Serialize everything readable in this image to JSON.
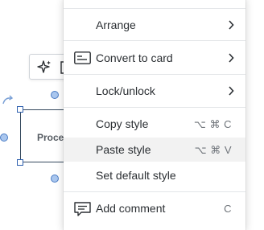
{
  "canvas": {
    "shape_label": "Proce"
  },
  "menu": {
    "arrange": {
      "label": "Arrange",
      "icon": "chevron-right-icon"
    },
    "convert_to_card": {
      "label": "Convert to card",
      "icon": "card-icon"
    },
    "lock_unlock": {
      "label": "Lock/unlock"
    },
    "copy_style": {
      "label": "Copy style",
      "shortcut": "⌥ ⌘ C"
    },
    "paste_style": {
      "label": "Paste style",
      "shortcut": "⌥ ⌘ V"
    },
    "set_default_style": {
      "label": "Set default style"
    },
    "add_comment": {
      "label": "Add comment",
      "shortcut": "C",
      "icon": "comment-icon"
    }
  },
  "colors": {
    "accent": "#2d5fae",
    "hover": "#f2f2f2",
    "shortcut": "#6f747a"
  }
}
